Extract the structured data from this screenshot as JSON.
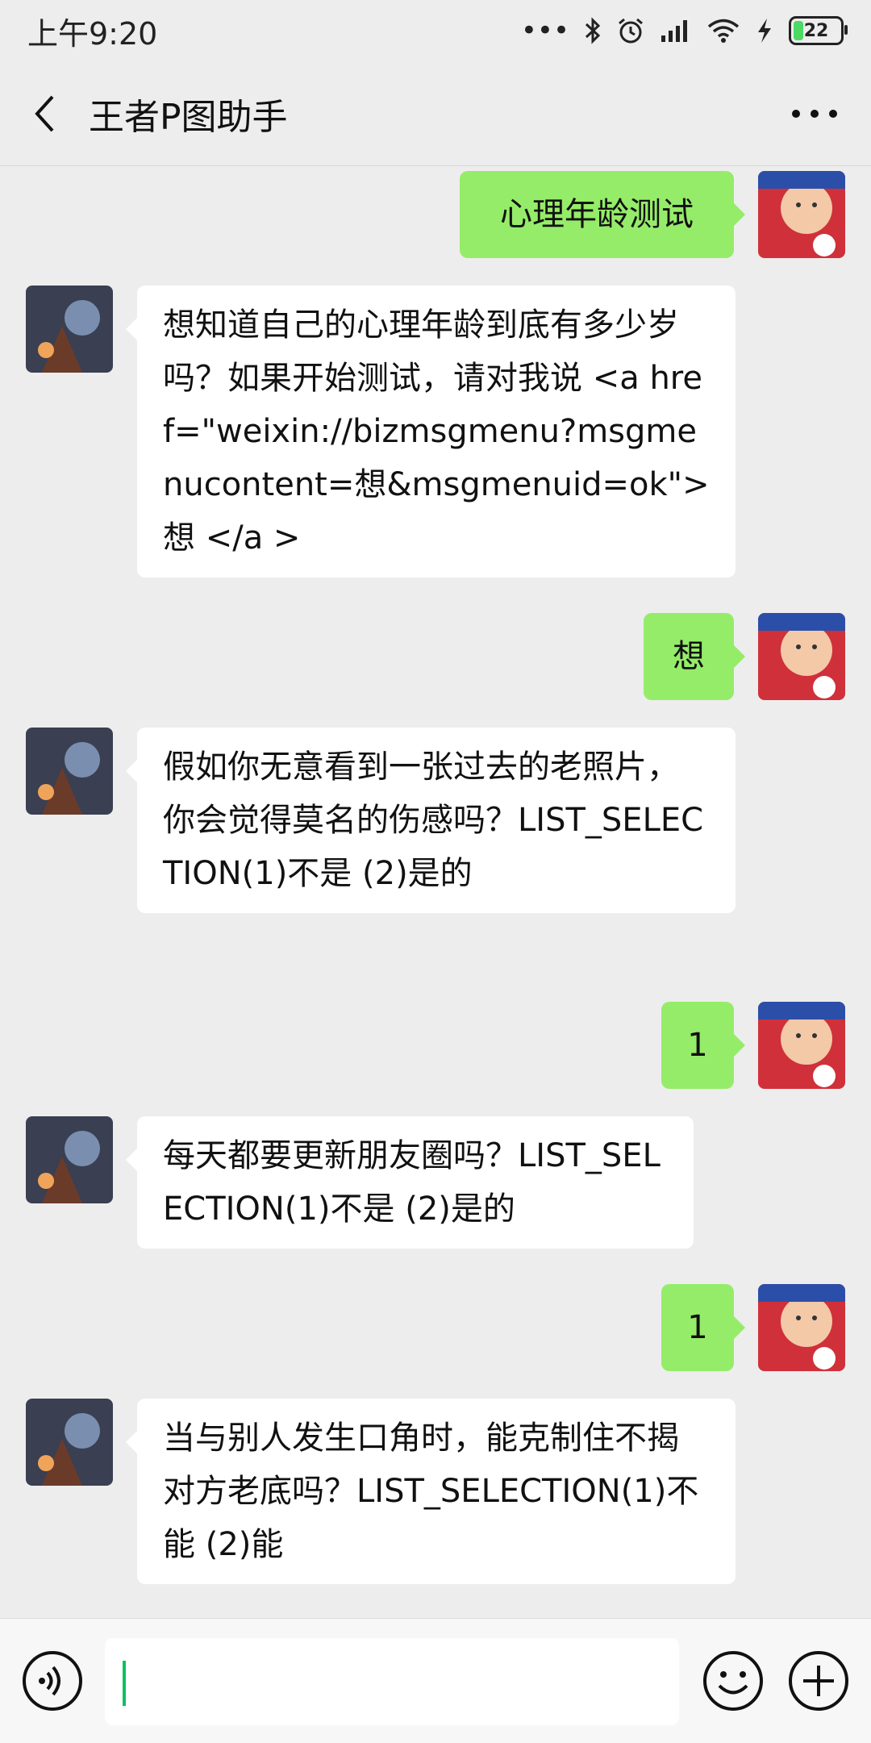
{
  "status_bar": {
    "time": "上午9:20",
    "signal_dots": "•••",
    "battery": "22"
  },
  "header": {
    "title": "王者P图助手"
  },
  "messages": [
    {
      "side": "out",
      "text": "心理年龄测试"
    },
    {
      "side": "in",
      "text": "想知道自己的心理年龄到底有多少岁吗？如果开始测试，请对我说 <a href=\"weixin://bizmsgmenu?msgmenucontent=想&msgmenuid=ok\">想 </a >"
    },
    {
      "side": "out",
      "text": "想"
    },
    {
      "side": "in",
      "text": "假如你无意看到一张过去的老照片，你会觉得莫名的伤感吗？LIST_SELECTION(1)不是 (2)是的"
    },
    {
      "side": "out",
      "text": "1"
    },
    {
      "side": "in",
      "text": "每天都要更新朋友圈吗？LIST_SELECTION(1)不是 (2)是的"
    },
    {
      "side": "out",
      "text": "1"
    },
    {
      "side": "in",
      "text": "当与别人发生口角时，能克制住不揭对方老底吗？LIST_SELECTION(1)不能 (2)能"
    }
  ],
  "input_bar": {
    "value": ""
  },
  "colors": {
    "outgoing_bubble": "#95ec69",
    "incoming_bubble": "#ffffff",
    "background": "#ededed",
    "cursor": "#07c160"
  },
  "icons": [
    "back-icon",
    "more-icon",
    "voice-icon",
    "emoji-icon",
    "plus-icon",
    "bluetooth-icon",
    "alarm-icon",
    "signal-icon",
    "wifi-icon",
    "charging-icon"
  ]
}
